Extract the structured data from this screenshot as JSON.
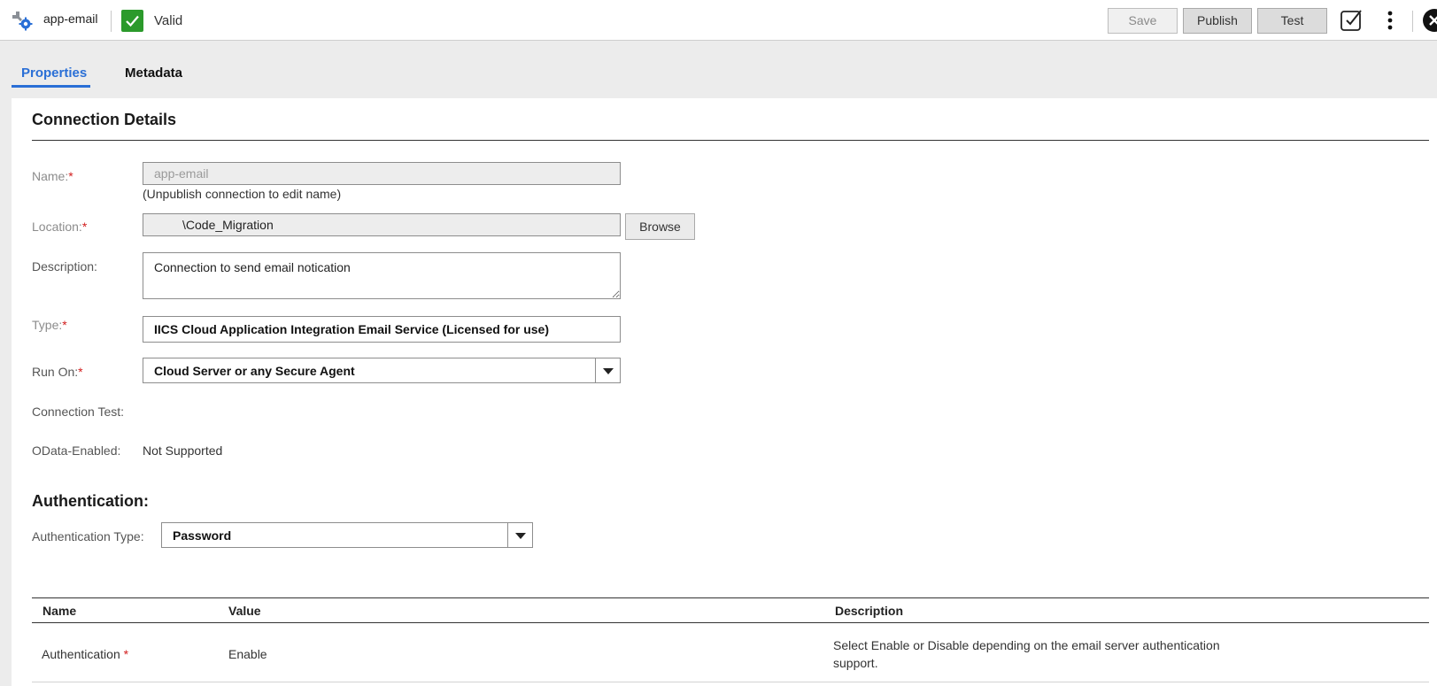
{
  "header": {
    "app_name": "app-email",
    "status": "Valid",
    "save_label": "Save",
    "publish_label": "Publish",
    "test_label": "Test"
  },
  "tabs": [
    {
      "label": "Properties",
      "active": true
    },
    {
      "label": "Metadata",
      "active": false
    }
  ],
  "connection_details": {
    "title": "Connection Details",
    "name_label": "Name:",
    "name_value": "app-email",
    "name_hint": "(Unpublish connection to edit name)",
    "location_label": "Location:",
    "location_value": "\\Code_Migration",
    "browse_label": "Browse",
    "description_label": "Description:",
    "description_value": "Connection to send email notication",
    "type_label": "Type:",
    "type_value": "IICS Cloud Application Integration Email Service (Licensed for use)",
    "run_on_label": "Run On:",
    "run_on_value": "Cloud Server or any Secure Agent",
    "connection_test_label": "Connection Test:",
    "odata_label": "OData-Enabled:",
    "odata_value": "Not Supported",
    "required_mark": "*"
  },
  "authentication": {
    "title": "Authentication:",
    "type_label": "Authentication Type:",
    "type_value": "Password"
  },
  "table": {
    "headers": [
      "Name",
      "Value",
      "Description"
    ],
    "rows": [
      {
        "name": "Authentication",
        "value": "Enable",
        "description_line1": "Select Enable or Disable depending on the email server authentication",
        "description_line2": "support."
      }
    ]
  },
  "colors": {
    "accent": "#2a6fd6",
    "valid_green": "#2b9a2b",
    "required_red": "#d21e1e"
  },
  "icons": {
    "app": "connection-gear-icon",
    "valid": "checkmark-icon",
    "check_in": "checkbox-check-icon",
    "more": "kebab-menu-icon",
    "close": "close-icon"
  }
}
